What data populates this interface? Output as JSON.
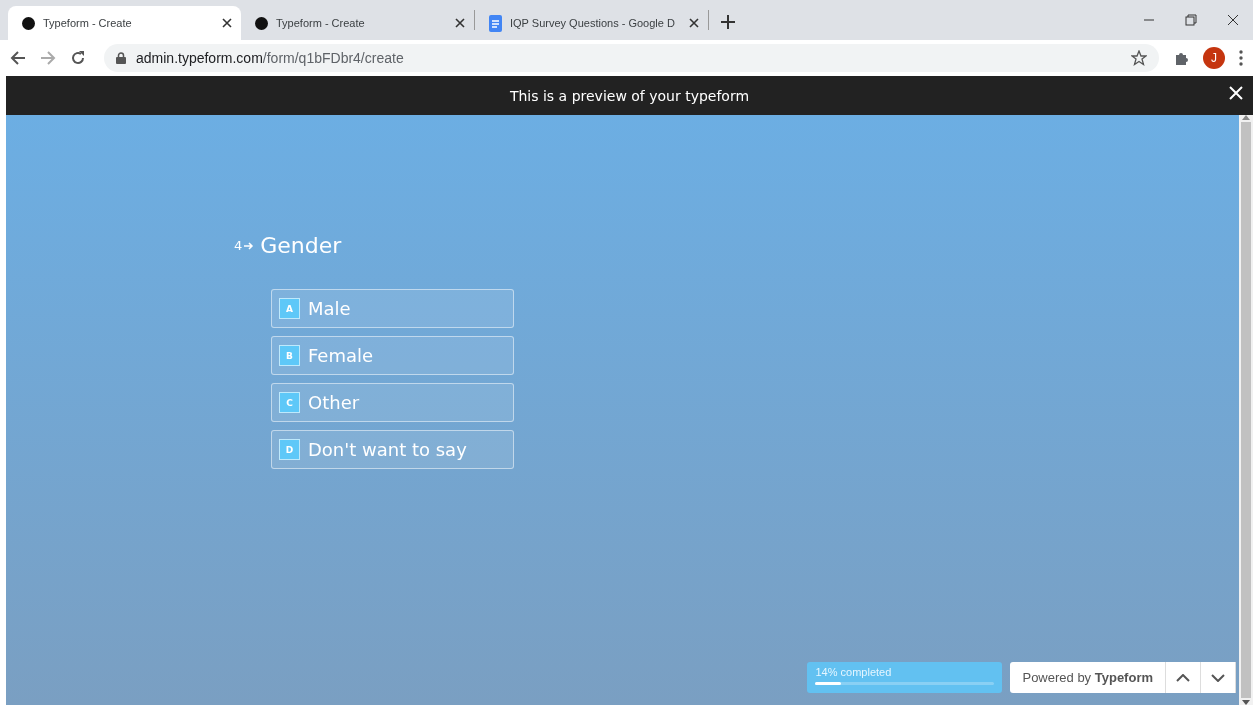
{
  "browser": {
    "tabs": [
      {
        "title": "Typeform - Create",
        "kind": "dot",
        "selected": true
      },
      {
        "title": "Typeform - Create",
        "kind": "dot",
        "selected": false
      },
      {
        "title": "IQP Survey Questions - Google D",
        "kind": "doc",
        "selected": false
      }
    ],
    "address": {
      "host": "admin.typeform.com",
      "path": "/form/q1bFDbr4/create"
    },
    "profile_initial": "J"
  },
  "preview_banner": {
    "text": "This is a preview of your typeform"
  },
  "question": {
    "number": "4",
    "title": "Gender",
    "choices": [
      {
        "key": "A",
        "label": "Male",
        "selected": false
      },
      {
        "key": "B",
        "label": "Female",
        "selected": false
      },
      {
        "key": "C",
        "label": "Other",
        "selected": false
      },
      {
        "key": "D",
        "label": "Don't want to say",
        "selected": false
      }
    ]
  },
  "progress": {
    "text": "14% completed",
    "level": 0.14
  },
  "powered_by": "Powered by **Typeform**"
}
